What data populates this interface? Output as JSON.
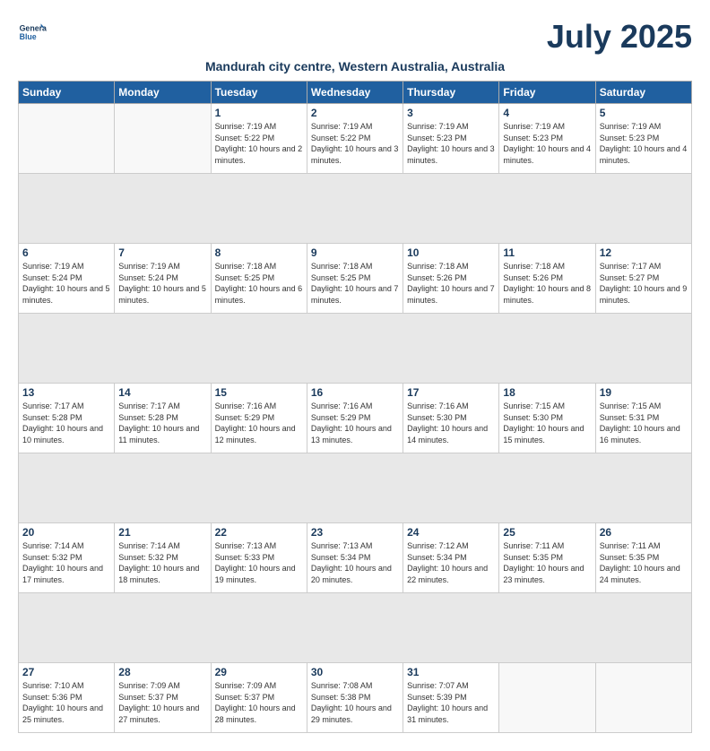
{
  "logo": {
    "line1": "General",
    "line2": "Blue"
  },
  "title": "July 2025",
  "subtitle": "Mandurah city centre, Western Australia, Australia",
  "days_of_week": [
    "Sunday",
    "Monday",
    "Tuesday",
    "Wednesday",
    "Thursday",
    "Friday",
    "Saturday"
  ],
  "weeks": [
    [
      {
        "day": "",
        "info": ""
      },
      {
        "day": "",
        "info": ""
      },
      {
        "day": "1",
        "info": "Sunrise: 7:19 AM\nSunset: 5:22 PM\nDaylight: 10 hours and 2 minutes."
      },
      {
        "day": "2",
        "info": "Sunrise: 7:19 AM\nSunset: 5:22 PM\nDaylight: 10 hours and 3 minutes."
      },
      {
        "day": "3",
        "info": "Sunrise: 7:19 AM\nSunset: 5:23 PM\nDaylight: 10 hours and 3 minutes."
      },
      {
        "day": "4",
        "info": "Sunrise: 7:19 AM\nSunset: 5:23 PM\nDaylight: 10 hours and 4 minutes."
      },
      {
        "day": "5",
        "info": "Sunrise: 7:19 AM\nSunset: 5:23 PM\nDaylight: 10 hours and 4 minutes."
      }
    ],
    [
      {
        "day": "6",
        "info": "Sunrise: 7:19 AM\nSunset: 5:24 PM\nDaylight: 10 hours and 5 minutes."
      },
      {
        "day": "7",
        "info": "Sunrise: 7:19 AM\nSunset: 5:24 PM\nDaylight: 10 hours and 5 minutes."
      },
      {
        "day": "8",
        "info": "Sunrise: 7:18 AM\nSunset: 5:25 PM\nDaylight: 10 hours and 6 minutes."
      },
      {
        "day": "9",
        "info": "Sunrise: 7:18 AM\nSunset: 5:25 PM\nDaylight: 10 hours and 7 minutes."
      },
      {
        "day": "10",
        "info": "Sunrise: 7:18 AM\nSunset: 5:26 PM\nDaylight: 10 hours and 7 minutes."
      },
      {
        "day": "11",
        "info": "Sunrise: 7:18 AM\nSunset: 5:26 PM\nDaylight: 10 hours and 8 minutes."
      },
      {
        "day": "12",
        "info": "Sunrise: 7:17 AM\nSunset: 5:27 PM\nDaylight: 10 hours and 9 minutes."
      }
    ],
    [
      {
        "day": "13",
        "info": "Sunrise: 7:17 AM\nSunset: 5:28 PM\nDaylight: 10 hours and 10 minutes."
      },
      {
        "day": "14",
        "info": "Sunrise: 7:17 AM\nSunset: 5:28 PM\nDaylight: 10 hours and 11 minutes."
      },
      {
        "day": "15",
        "info": "Sunrise: 7:16 AM\nSunset: 5:29 PM\nDaylight: 10 hours and 12 minutes."
      },
      {
        "day": "16",
        "info": "Sunrise: 7:16 AM\nSunset: 5:29 PM\nDaylight: 10 hours and 13 minutes."
      },
      {
        "day": "17",
        "info": "Sunrise: 7:16 AM\nSunset: 5:30 PM\nDaylight: 10 hours and 14 minutes."
      },
      {
        "day": "18",
        "info": "Sunrise: 7:15 AM\nSunset: 5:30 PM\nDaylight: 10 hours and 15 minutes."
      },
      {
        "day": "19",
        "info": "Sunrise: 7:15 AM\nSunset: 5:31 PM\nDaylight: 10 hours and 16 minutes."
      }
    ],
    [
      {
        "day": "20",
        "info": "Sunrise: 7:14 AM\nSunset: 5:32 PM\nDaylight: 10 hours and 17 minutes."
      },
      {
        "day": "21",
        "info": "Sunrise: 7:14 AM\nSunset: 5:32 PM\nDaylight: 10 hours and 18 minutes."
      },
      {
        "day": "22",
        "info": "Sunrise: 7:13 AM\nSunset: 5:33 PM\nDaylight: 10 hours and 19 minutes."
      },
      {
        "day": "23",
        "info": "Sunrise: 7:13 AM\nSunset: 5:34 PM\nDaylight: 10 hours and 20 minutes."
      },
      {
        "day": "24",
        "info": "Sunrise: 7:12 AM\nSunset: 5:34 PM\nDaylight: 10 hours and 22 minutes."
      },
      {
        "day": "25",
        "info": "Sunrise: 7:11 AM\nSunset: 5:35 PM\nDaylight: 10 hours and 23 minutes."
      },
      {
        "day": "26",
        "info": "Sunrise: 7:11 AM\nSunset: 5:35 PM\nDaylight: 10 hours and 24 minutes."
      }
    ],
    [
      {
        "day": "27",
        "info": "Sunrise: 7:10 AM\nSunset: 5:36 PM\nDaylight: 10 hours and 25 minutes."
      },
      {
        "day": "28",
        "info": "Sunrise: 7:09 AM\nSunset: 5:37 PM\nDaylight: 10 hours and 27 minutes."
      },
      {
        "day": "29",
        "info": "Sunrise: 7:09 AM\nSunset: 5:37 PM\nDaylight: 10 hours and 28 minutes."
      },
      {
        "day": "30",
        "info": "Sunrise: 7:08 AM\nSunset: 5:38 PM\nDaylight: 10 hours and 29 minutes."
      },
      {
        "day": "31",
        "info": "Sunrise: 7:07 AM\nSunset: 5:39 PM\nDaylight: 10 hours and 31 minutes."
      },
      {
        "day": "",
        "info": ""
      },
      {
        "day": "",
        "info": ""
      }
    ]
  ]
}
